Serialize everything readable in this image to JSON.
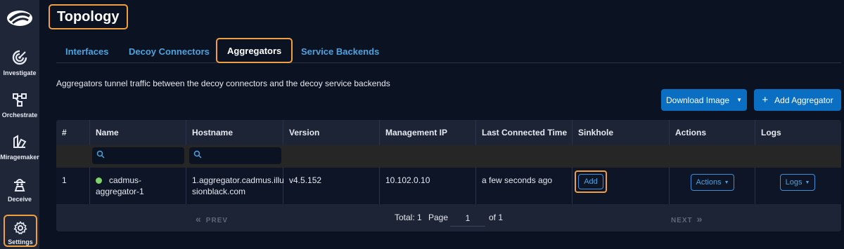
{
  "sidebar": {
    "items": [
      {
        "label": "Investigate",
        "icon": "investigate-icon"
      },
      {
        "label": "Orchestrate",
        "icon": "orchestrate-icon"
      },
      {
        "label": "Miragemaker",
        "icon": "miragemaker-icon"
      },
      {
        "label": "Deceive",
        "icon": "deceive-icon"
      },
      {
        "label": "Settings",
        "icon": "gear-icon"
      }
    ]
  },
  "page": {
    "title": "Topology",
    "description": "Aggregators tunnel traffic between the decoy connectors and the decoy service backends"
  },
  "tabs": [
    {
      "label": "Interfaces"
    },
    {
      "label": "Decoy Connectors"
    },
    {
      "label": "Aggregators"
    },
    {
      "label": "Service Backends"
    }
  ],
  "toolbar": {
    "download_label": "Download Image",
    "add_label": "Add Aggregator"
  },
  "table": {
    "columns": [
      "#",
      "Name",
      "Hostname",
      "Version",
      "Management IP",
      "Last Connected Time",
      "Sinkhole",
      "Actions",
      "Logs"
    ],
    "rows": [
      {
        "index": "1",
        "name_line1": "cadmus-",
        "name_line2": "aggregator-1",
        "hostname_line1": "1.aggregator.cadmus.illu",
        "hostname_line2": "sionblack.com",
        "version": "v4.5.152",
        "management_ip": "10.102.0.10",
        "last_connected": "a few seconds ago",
        "sinkhole_button": "Add",
        "actions_button": "Actions",
        "logs_button": "Logs",
        "status_color": "#7ed36b"
      }
    ]
  },
  "pager": {
    "prev": "PREV",
    "next": "NEXT",
    "total": "Total: 1",
    "page_label": "Page",
    "page_value": "1",
    "of": "of 1"
  },
  "colors": {
    "accent": "#0a6fc2",
    "highlight": "#f0a040",
    "tab_link": "#4da3e0"
  }
}
